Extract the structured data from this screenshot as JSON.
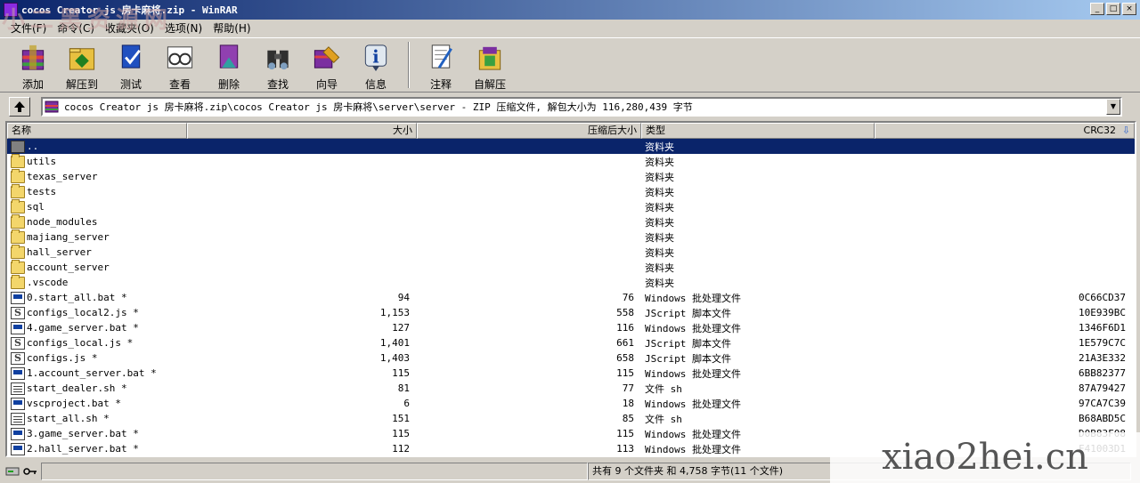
{
  "window": {
    "title": "cocos Creator js 房卡麻将.zip - WinRAR",
    "buttons": [
      "_",
      "□",
      "×"
    ]
  },
  "menu": [
    {
      "label": "文件(F)"
    },
    {
      "label": "命令(C)"
    },
    {
      "label": "收藏夹(O)"
    },
    {
      "label": "选项(N)"
    },
    {
      "label": "帮助(H)"
    }
  ],
  "toolbar": [
    {
      "label": "添加",
      "icon": "add-icon"
    },
    {
      "label": "解压到",
      "icon": "extract-icon"
    },
    {
      "label": "测试",
      "icon": "test-icon"
    },
    {
      "label": "查看",
      "icon": "view-icon"
    },
    {
      "label": "删除",
      "icon": "delete-icon"
    },
    {
      "label": "查找",
      "icon": "find-icon"
    },
    {
      "label": "向导",
      "icon": "wizard-icon"
    },
    {
      "label": "信息",
      "icon": "info-icon"
    },
    {
      "label": "注释",
      "icon": "comment-icon"
    },
    {
      "label": "自解压",
      "icon": "sfx-icon"
    }
  ],
  "address": {
    "path": "cocos Creator js 房卡麻将.zip\\cocos Creator js 房卡麻将\\server\\server - ZIP 压缩文件, 解包大小为 116,280,439 字节"
  },
  "columns": {
    "name": "名称",
    "size": "大小",
    "packed": "压缩后大小",
    "type": "类型",
    "crc": "CRC32"
  },
  "files": [
    {
      "name": "..",
      "size": "",
      "packed": "",
      "type": "资料夹",
      "crc": "",
      "icon": "folder-up",
      "selected": true
    },
    {
      "name": "utils",
      "size": "",
      "packed": "",
      "type": "资料夹",
      "crc": "",
      "icon": "folder"
    },
    {
      "name": "texas_server",
      "size": "",
      "packed": "",
      "type": "资料夹",
      "crc": "",
      "icon": "folder"
    },
    {
      "name": "tests",
      "size": "",
      "packed": "",
      "type": "资料夹",
      "crc": "",
      "icon": "folder"
    },
    {
      "name": "sql",
      "size": "",
      "packed": "",
      "type": "资料夹",
      "crc": "",
      "icon": "folder"
    },
    {
      "name": "node_modules",
      "size": "",
      "packed": "",
      "type": "资料夹",
      "crc": "",
      "icon": "folder"
    },
    {
      "name": "majiang_server",
      "size": "",
      "packed": "",
      "type": "资料夹",
      "crc": "",
      "icon": "folder"
    },
    {
      "name": "hall_server",
      "size": "",
      "packed": "",
      "type": "资料夹",
      "crc": "",
      "icon": "folder"
    },
    {
      "name": "account_server",
      "size": "",
      "packed": "",
      "type": "资料夹",
      "crc": "",
      "icon": "folder"
    },
    {
      "name": ".vscode",
      "size": "",
      "packed": "",
      "type": "资料夹",
      "crc": "",
      "icon": "folder"
    },
    {
      "name": "0.start_all.bat *",
      "size": "94",
      "packed": "76",
      "type": "Windows 批处理文件",
      "crc": "0C66CD37",
      "icon": "bat"
    },
    {
      "name": "configs_local2.js *",
      "size": "1,153",
      "packed": "558",
      "type": "JScript 脚本文件",
      "crc": "10E939BC",
      "icon": "js"
    },
    {
      "name": "4.game_server.bat *",
      "size": "127",
      "packed": "116",
      "type": "Windows 批处理文件",
      "crc": "1346F6D1",
      "icon": "bat"
    },
    {
      "name": "configs_local.js *",
      "size": "1,401",
      "packed": "661",
      "type": "JScript 脚本文件",
      "crc": "1E579C7C",
      "icon": "js"
    },
    {
      "name": "configs.js *",
      "size": "1,403",
      "packed": "658",
      "type": "JScript 脚本文件",
      "crc": "21A3E332",
      "icon": "js"
    },
    {
      "name": "1.account_server.bat *",
      "size": "115",
      "packed": "115",
      "type": "Windows 批处理文件",
      "crc": "6BB82377",
      "icon": "bat"
    },
    {
      "name": "start_dealer.sh *",
      "size": "81",
      "packed": "77",
      "type": "文件 sh",
      "crc": "87A79427",
      "icon": "sh"
    },
    {
      "name": "vscproject.bat *",
      "size": "6",
      "packed": "18",
      "type": "Windows 批处理文件",
      "crc": "97CA7C39",
      "icon": "bat"
    },
    {
      "name": "start_all.sh *",
      "size": "151",
      "packed": "85",
      "type": "文件 sh",
      "crc": "B68ABD5C",
      "icon": "sh"
    },
    {
      "name": "3.game_server.bat *",
      "size": "115",
      "packed": "115",
      "type": "Windows 批处理文件",
      "crc": "D0B83F08",
      "icon": "bat"
    },
    {
      "name": "2.hall_server.bat *",
      "size": "112",
      "packed": "113",
      "type": "Windows 批处理文件",
      "crc": "F41003D1",
      "icon": "bat"
    }
  ],
  "status": {
    "left": "",
    "summary": "共有 9 个文件夹 和 4,758 字节(11 个文件)"
  },
  "watermarks": {
    "top_left": "小二黑资源网",
    "bottom_right": "xiao2hei.cn"
  }
}
